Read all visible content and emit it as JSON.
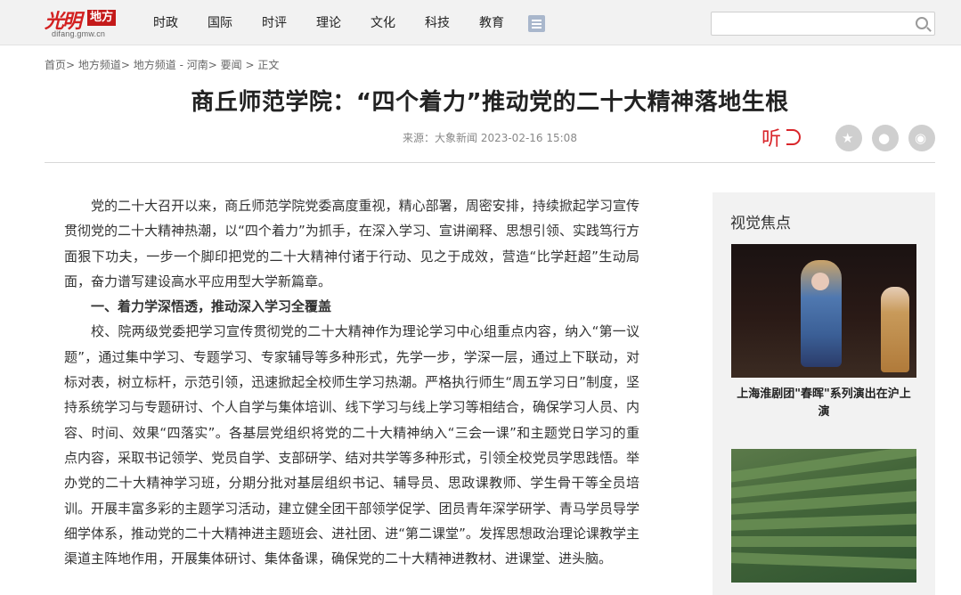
{
  "header": {
    "logo_brand": "光明",
    "logo_box": "地方",
    "logo_domain": "difang.gmw.cn",
    "nav_items": [
      "时政",
      "国际",
      "时评",
      "理论",
      "文化",
      "科技",
      "教育"
    ],
    "search_placeholder": ""
  },
  "breadcrumb": {
    "items": [
      "首页>",
      "地方频道>",
      "地方频道 - 河南>",
      "要闻 >",
      "正文"
    ]
  },
  "article": {
    "title": "商丘师范学院：“四个着力”推动党的二十大精神落地生根",
    "meta": "来源：大象新闻   2023-02-16 15:08",
    "listen_label": "听",
    "paragraphs": [
      "党的二十大召开以来，商丘师范学院党委高度重视，精心部署，周密安排，持续掀起学习宣传贯彻党的二十大精神热潮，以“四个着力”为抓手，在深入学习、宣讲阐释、思想引领、实践笃行方面狠下功夫，一步一个脚印把党的二十大精神付诸于行动、见之于成效，营造“比学赶超”生动局面，奋力谱写建设高水平应用型大学新篇章。",
      "一、着力学深悟透，推动深入学习全覆盖",
      "校、院两级党委把学习宣传贯彻党的二十大精神作为理论学习中心组重点内容，纳入“第一议题”，通过集中学习、专题学习、专家辅导等多种形式，先学一步，学深一层，通过上下联动，对标对表，树立标杆，示范引领，迅速掀起全校师生学习热潮。严格执行师生“周五学习日”制度，坚持系统学习与专题研讨、个人自学与集体培训、线下学习与线上学习等相结合，确保学习人员、内容、时间、效果“四落实”。各基层党组织将党的二十大精神纳入“三会一课”和主题党日学习的重点内容，采取书记领学、党员自学、支部研学、结对共学等多种形式，引领全校党员学思践悟。举办党的二十大精神学习班，分期分批对基层组织书记、辅导员、思政课教师、学生骨干等全员培训。开展丰富多彩的主题学习活动，建立健全团干部领学促学、团员青年深学研学、青马学员导学细学体系，推动党的二十大精神进主题班会、进社团、进“第二课堂”。发挥思想政治理论课教学主渠道主阵地作用，开展集体研讨、集体备课，确保党的二十大精神进教材、进课堂、进头脑。"
    ]
  },
  "sidebar": {
    "title": "视觉焦点",
    "items": [
      {
        "caption": "上海淮剧团\"春晖\"系列演出在沪上演"
      },
      {
        "caption": ""
      }
    ]
  }
}
